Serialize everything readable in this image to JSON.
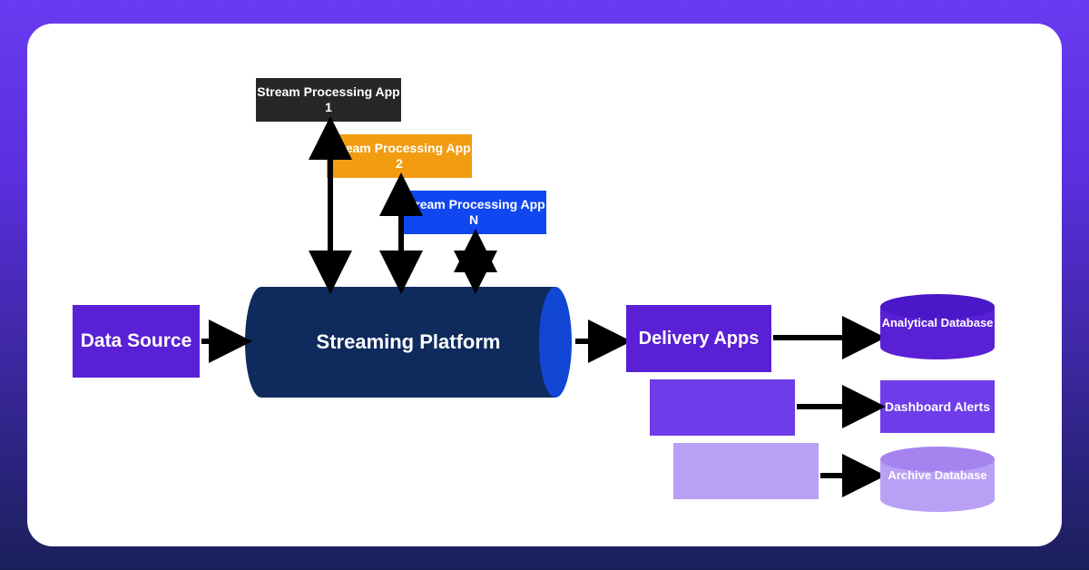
{
  "diagram": {
    "data_source": "Data Source",
    "streaming_platform": "Streaming Platform",
    "apps": {
      "app1": "Stream Processing App 1",
      "app2": "Stream Processing App 2",
      "app3": "Stream Processing App N"
    },
    "delivery": "Delivery Apps",
    "outputs": {
      "analytical_db": "Analytical Database",
      "dashboard_alerts": "Dashboard Alerts",
      "archive_db": "Archive Database"
    }
  },
  "colors": {
    "data_source": "#5A20D6",
    "platform_body": "#0F2A5C",
    "platform_cap": "#1147D4",
    "app1": "#272727",
    "app2": "#F29C12",
    "app3": "#1147F0",
    "delivery1": "#5A20D6",
    "delivery2": "#6E3CE8",
    "delivery3": "#B9A0F5",
    "analytical_db": "#5A20D6",
    "dashboard": "#6E3CE8",
    "archive_db": "#B9A0F5",
    "arrow": "#000000"
  }
}
